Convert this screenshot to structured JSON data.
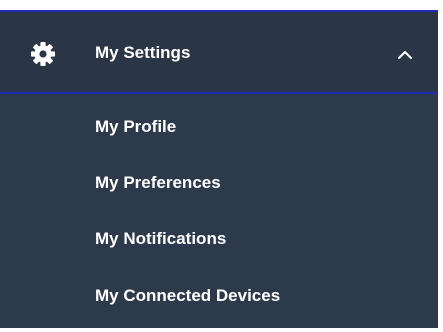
{
  "menu": {
    "header": {
      "label": "My Settings",
      "icon": "gear-icon",
      "toggle_icon": "chevron-up-icon",
      "expanded": true
    },
    "items": [
      {
        "label": "My Profile"
      },
      {
        "label": "My Preferences"
      },
      {
        "label": "My Notifications"
      },
      {
        "label": "My Connected Devices"
      }
    ]
  },
  "colors": {
    "panel_background": "#2d3a4b",
    "header_border": "#1f2ab5",
    "text": "#ffffff"
  }
}
